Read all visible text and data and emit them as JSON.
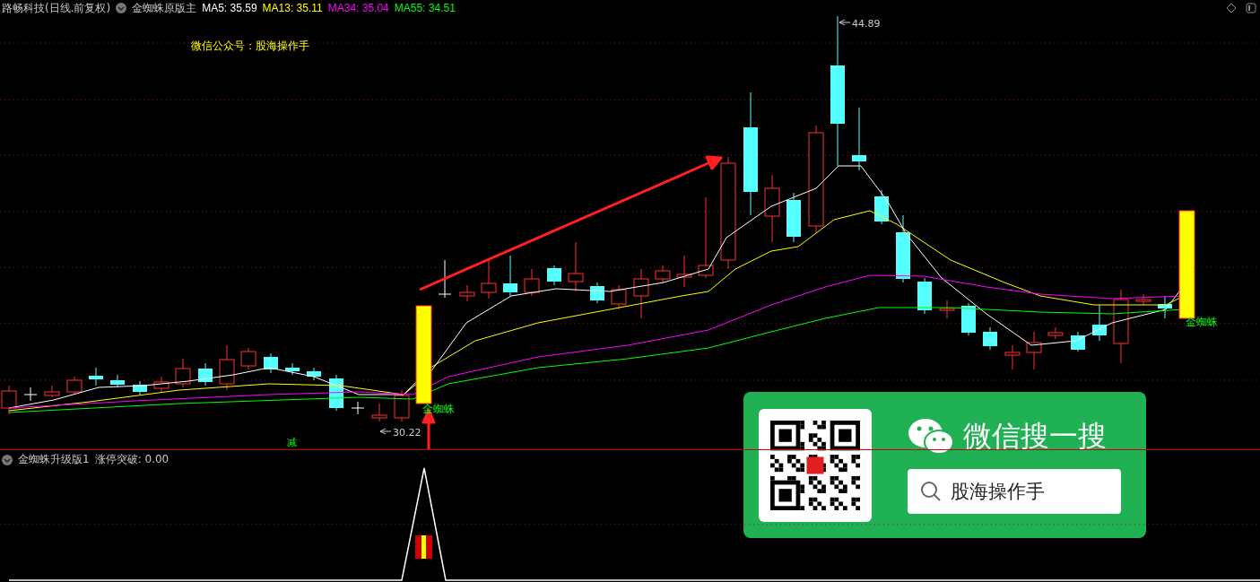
{
  "header": {
    "stock": "路畅科技(日线.前复权)",
    "indicator": "金蜘蛛原版主",
    "ma": [
      {
        "label": "MA5: 35.59",
        "color": "#ffffff"
      },
      {
        "label": "MA13: 35.11",
        "color": "#ffff00"
      },
      {
        "label": "MA34: 35.04",
        "color": "#ff00ff"
      },
      {
        "label": "MA55: 34.51",
        "color": "#00ff00"
      }
    ]
  },
  "chart": {
    "note": "微信公众号：股海操作手",
    "high_label": "44.89",
    "low_label": "30.22",
    "signals": [
      "金蜘蛛",
      "金蜘蛛"
    ],
    "marker": "减"
  },
  "sub_panel": {
    "indicator": "金蜘蛛升级版1",
    "reading": "涨停突破: 0.00"
  },
  "wechat_card": {
    "title": "微信搜一搜",
    "search": "股海操作手"
  }
}
